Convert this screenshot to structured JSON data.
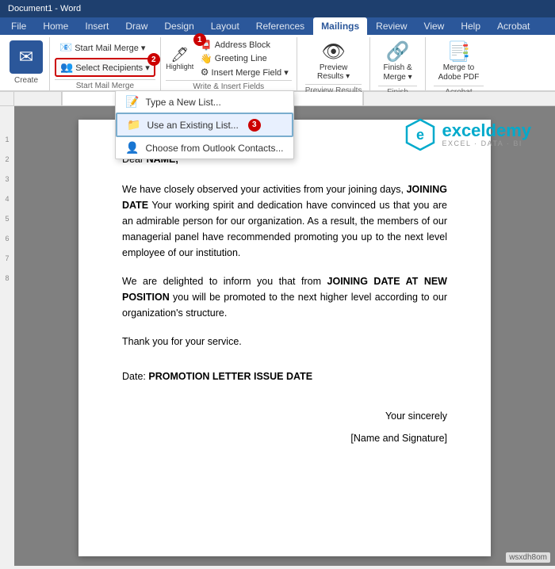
{
  "title": "Document1 - Word",
  "tabs": [
    {
      "label": "File",
      "active": false
    },
    {
      "label": "Home",
      "active": false
    },
    {
      "label": "Insert",
      "active": false
    },
    {
      "label": "Draw",
      "active": false
    },
    {
      "label": "Design",
      "active": false
    },
    {
      "label": "Layout",
      "active": false
    },
    {
      "label": "References",
      "active": false
    },
    {
      "label": "Mailings",
      "active": true
    },
    {
      "label": "Review",
      "active": false
    },
    {
      "label": "View",
      "active": false
    },
    {
      "label": "Help",
      "active": false
    },
    {
      "label": "Acrobat",
      "active": false
    }
  ],
  "ribbon": {
    "groups": [
      {
        "name": "create",
        "label": "Create",
        "buttons": [
          {
            "label": "Create",
            "icon": "📄"
          }
        ]
      },
      {
        "name": "start-mail-merge",
        "label": "Start Mail Merge",
        "buttons": [
          {
            "label": "Start Mail Merge",
            "icon": "📧",
            "has_arrow": true
          },
          {
            "label": "Select Recipients",
            "icon": "👥",
            "has_arrow": true,
            "badge": "2",
            "active": true
          }
        ]
      },
      {
        "name": "write-insert",
        "label": "Write & Insert Fields",
        "buttons": [
          {
            "label": "Highlight",
            "icon": "🖊"
          },
          {
            "label": "Address Block",
            "icon": "📮",
            "badge": "1"
          },
          {
            "label": "Greeting Line",
            "icon": "👋"
          },
          {
            "label": "Insert Merge Field",
            "icon": "⚙",
            "has_arrow": true
          }
        ]
      },
      {
        "name": "preview",
        "label": "Preview Results",
        "buttons": [
          {
            "label": "Preview Results",
            "icon": "👁"
          }
        ]
      },
      {
        "name": "finish",
        "label": "Finish",
        "buttons": [
          {
            "label": "Finish & Merge",
            "icon": "🔗"
          }
        ]
      },
      {
        "name": "acrobat",
        "label": "Acrobat",
        "buttons": [
          {
            "label": "Merge to Adobe PDF",
            "icon": "📑"
          }
        ]
      }
    ]
  },
  "dropdown": {
    "visible": true,
    "items": [
      {
        "label": "Type a New List...",
        "icon": "📝",
        "badge": null,
        "highlighted": false
      },
      {
        "label": "Use an Existing List...",
        "icon": "📁",
        "badge": "3",
        "highlighted": true
      },
      {
        "label": "Choose from Outlook Contacts...",
        "icon": "👤",
        "badge": null,
        "highlighted": false
      }
    ]
  },
  "document": {
    "greeting": "Dear ",
    "greeting_field": "NAME,",
    "para1_start": "We have closely observed your activities from your joining days, ",
    "para1_field1": "JOINING DATE",
    "para1_mid": " Your working spirit and dedication have convinced us that you are an admirable person for our organization. As a result, the members of our managerial panel have recommended promoting you up to the next level employee of our institution.",
    "para2_start": "We are delighted to inform you that from ",
    "para2_field": "JOINING DATE AT NEW POSITION",
    "para2_end": " you will be promoted to the next higher level according to our organization's structure.",
    "thanks": "Thank you for your service.",
    "date_label": "Date: ",
    "date_field": "PROMOTION LETTER ISSUE DATE",
    "closing": "Your sincerely",
    "signature": "[Name and Signature]"
  },
  "logo": {
    "name": "exceldemy",
    "tagline": "EXCEL · DATA · BI"
  },
  "watermark": "wsxdh8om"
}
